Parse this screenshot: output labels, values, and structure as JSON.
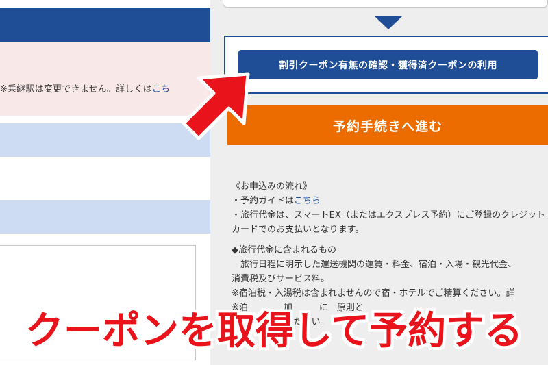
{
  "left": {
    "notice_text": "※乗継駅は変更できません。詳しくは",
    "notice_link": "こち"
  },
  "right": {
    "coupon_button_label": "割引クーポン有無の確認・獲得済クーポンの利用",
    "proceed_button_label": "予約手続きへ進む",
    "flow": {
      "heading": "《お申込みの流れ》",
      "guide_prefix": "・予約ガイドは",
      "guide_link": "こちら",
      "payment_line1": "・旅行代金は、スマートEX（またはエクスプレス予約）にご登録のクレジット",
      "payment_line2": "カードでのお支払いとなります。"
    },
    "included": {
      "heading": "◆旅行代金に含まれるもの",
      "line1": "　旅行日程に明示した運送機関の運賃・料金、宿泊・入場・観光代金、",
      "line2": "消費税及びサービス料。",
      "line3": "※宿泊税・入湯税は含まれませんので宿・ホテルでご精算ください。詳",
      "line4": "※泊　　　　加　　　に　原則と　　　　　　　　　　　　",
      "line5": "にてお支払いください。"
    }
  },
  "overlay": {
    "caption": "クーポンを取得して予約する",
    "caption_color": "#e8131b",
    "arrow_color": "#e8131b"
  },
  "colors": {
    "brand_blue": "#1f4e96",
    "proceed_orange": "#ec6c00",
    "notice_pink": "#f9e8e8",
    "band_blue": "#cddcf3"
  }
}
